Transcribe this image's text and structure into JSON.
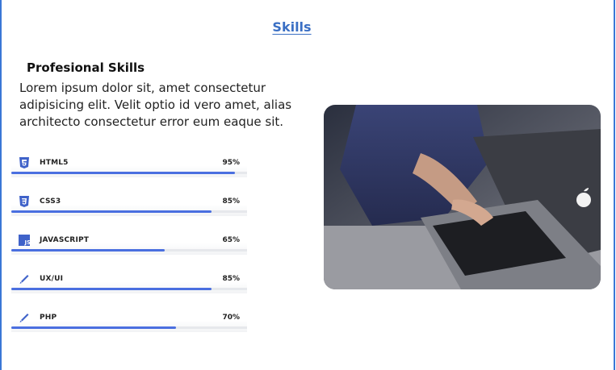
{
  "section": {
    "title": "Skills"
  },
  "skills_section": {
    "heading": "Profesional Skills",
    "lead": "Lorem ipsum dolor sit, amet consectetur adipisicing elit. Velit optio id vero amet, alias architecto consectetur error eum eaque sit."
  },
  "skills": [
    {
      "name": "HTML5",
      "percent_label": "95%",
      "level": 0.95,
      "icon": "html5-icon"
    },
    {
      "name": "CSS3",
      "percent_label": "85%",
      "level": 0.85,
      "icon": "css3-icon"
    },
    {
      "name": "JAVASCRIPT",
      "percent_label": "65%",
      "level": 0.65,
      "icon": "javascript-icon"
    },
    {
      "name": "UX/UI",
      "percent_label": "85%",
      "level": 0.85,
      "icon": "pencil-icon"
    },
    {
      "name": "PHP",
      "percent_label": "70%",
      "level": 0.7,
      "icon": "pencil-icon"
    }
  ],
  "colors": {
    "accent": "#3a6fc4",
    "bar": "#4a6fe0",
    "frame": "#3a77d6"
  }
}
